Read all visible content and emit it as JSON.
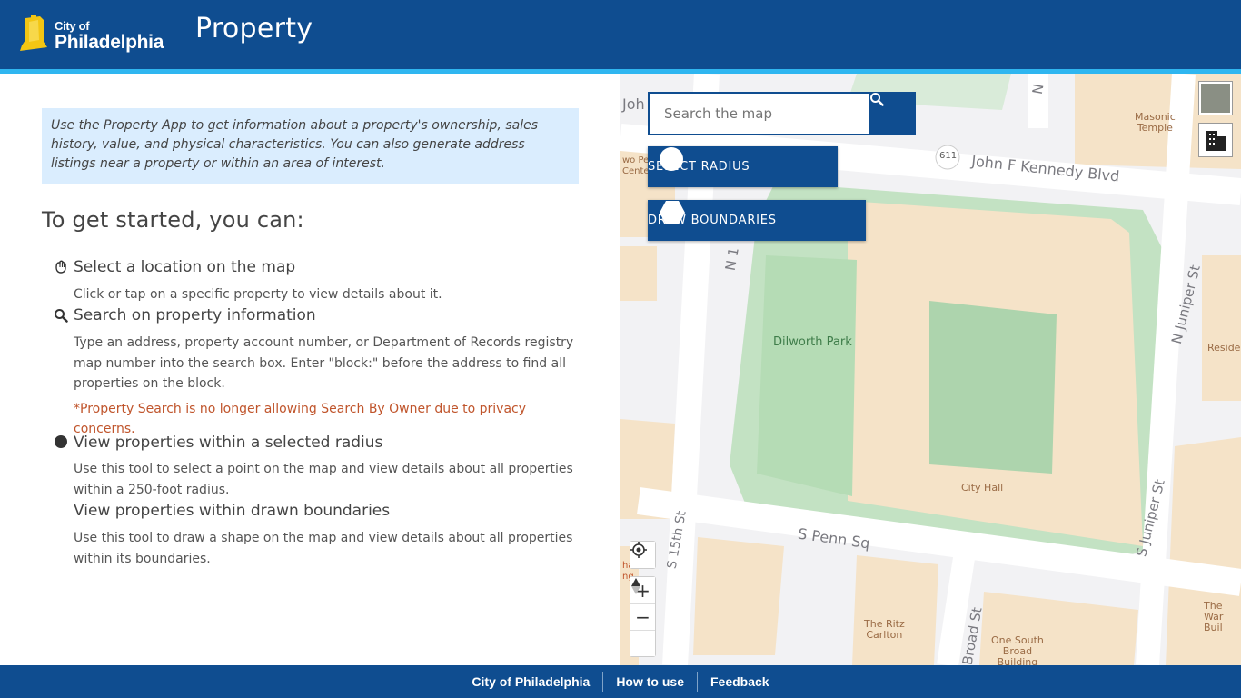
{
  "header": {
    "logo_small": "City of",
    "logo_big": "Philadelphia",
    "app_title": "Property"
  },
  "intro": "Use the Property App to get information about a property's ownership, sales history, value, and physical characteristics. You can also generate address listings near a property or within an area of interest.",
  "get_started": "To get started, you can:",
  "options": [
    {
      "icon": "hand-pointer-icon",
      "title": "Select a location on the map",
      "desc": "Click or tap on a specific property to view details about it."
    },
    {
      "icon": "search-icon",
      "title": "Search on property information",
      "desc": "Type an address, property account number, or Department of Records registry map number into the search box. Enter \"block:\" before the address to find all properties on the block.",
      "warning": "*Property Search is no longer allowing Search By Owner due to privacy concerns."
    },
    {
      "icon": "circle-icon",
      "title": "View properties within a selected radius",
      "desc": "Use this tool to select a point on the map and view details about all properties within a 250-foot radius."
    },
    {
      "icon": "",
      "title": "View properties within drawn boundaries",
      "desc": "Use this tool to draw a shape on the map and view details about all properties within its boundaries."
    }
  ],
  "map": {
    "search_placeholder": "Search the map",
    "select_radius": "SELECT RADIUS",
    "draw_boundaries": "DRAW BOUNDARIES",
    "zoom_in": "+",
    "zoom_out": "−",
    "labels": {
      "jfk": "John F Kennedy Blvd",
      "penn": "S Penn Sq",
      "dilworth": "Dilworth Park",
      "city_hall": "City Hall",
      "masonic": "Masonic\nTemple",
      "n_juniper": "N Juniper St",
      "s_juniper": "S Juniper St",
      "s15": "S 15th St",
      "broad": "Broad St",
      "ritz": "The Ritz\nCarlton",
      "one_south": "One South\nBroad\nBuilding",
      "route": "611",
      "reside": "Reside",
      "the_war": "The War\nBuil",
      "n_st": "N",
      "n1": "N 1",
      "joh": "Joh",
      "wo_pe": "wo Pe\nCente",
      "ha": "ha\nng"
    }
  },
  "footer": {
    "link1": "City of Philadelphia",
    "link2": "How to use",
    "link3": "Feedback"
  }
}
